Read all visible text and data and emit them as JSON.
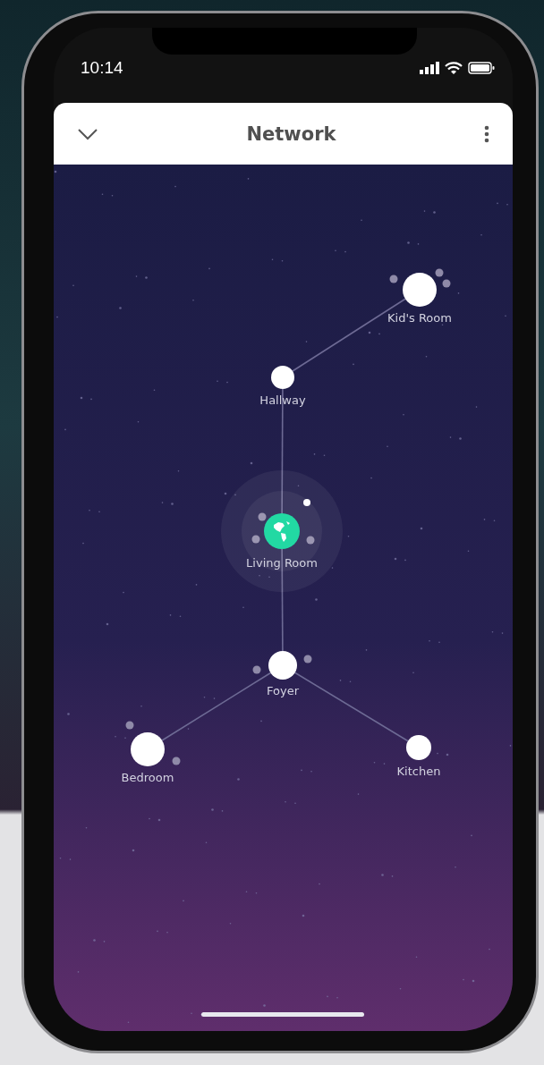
{
  "status_bar": {
    "time": "10:14"
  },
  "header": {
    "title": "Network"
  },
  "network": {
    "label": "Living Room",
    "kind": "hub",
    "children": [
      {
        "label": "Hallway",
        "kind": "room",
        "children": [
          {
            "label": "Kid's Room",
            "kind": "room"
          }
        ]
      },
      {
        "label": "Foyer",
        "kind": "room",
        "children": [
          {
            "label": "Bedroom",
            "kind": "room"
          },
          {
            "label": "Kitchen",
            "kind": "room"
          }
        ]
      }
    ]
  }
}
